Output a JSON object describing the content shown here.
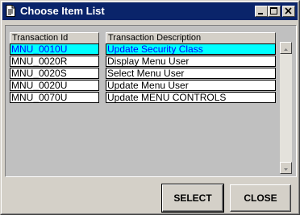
{
  "window": {
    "title": "Choose Item List",
    "icon": "document-icon"
  },
  "titlebar_buttons": {
    "minimize": "minimize-icon",
    "maximize": "maximize-icon",
    "close": "close-icon"
  },
  "table": {
    "columns": [
      "Transaction Id",
      "Transaction Description"
    ],
    "rows": [
      {
        "id": "MNU_0010U",
        "description": "Update Security Class",
        "selected": true
      },
      {
        "id": "MNU_0020R",
        "description": "Display Menu User",
        "selected": false
      },
      {
        "id": "MNU_0020S",
        "description": "Select Menu User",
        "selected": false
      },
      {
        "id": "MNU_0020U",
        "description": "Update Menu User",
        "selected": false
      },
      {
        "id": "MNU_0070U",
        "description": "Update MENU CONTROLS",
        "selected": false
      }
    ]
  },
  "buttons": {
    "select": "SELECT",
    "close": "CLOSE"
  },
  "colors": {
    "titlebar": "#0a246a",
    "selected_row_bg": "#00ffff",
    "selected_row_text": "#0000ff",
    "window_bg": "#d4d0c8"
  }
}
